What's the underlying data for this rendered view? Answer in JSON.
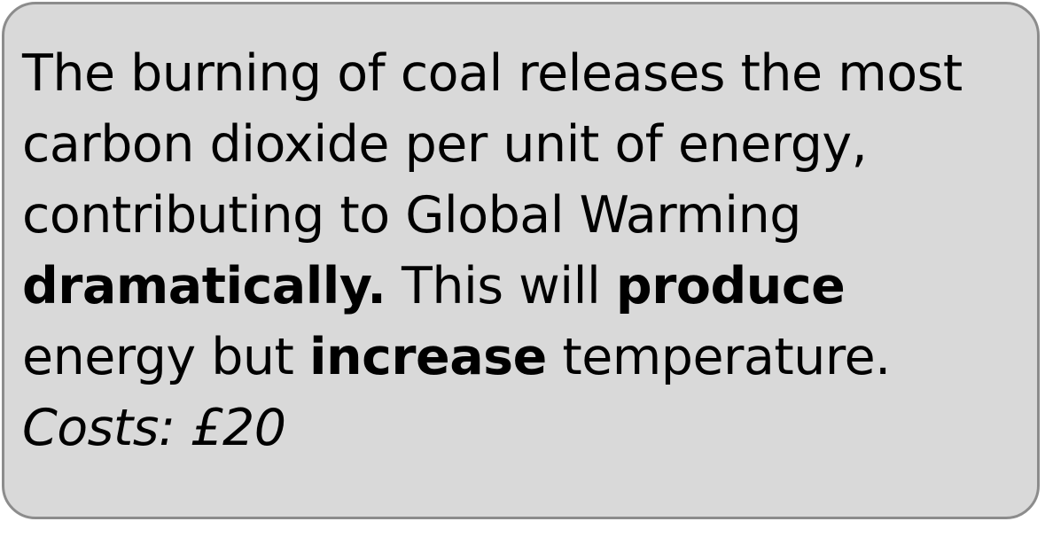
{
  "card": {
    "line1": "The burning of coal releases the most",
    "line2": "carbon dioxide per unit of energy,",
    "line3": "contributing to Global Warming",
    "line4_bold_a": "dramatically.",
    "line4_plain": " This will ",
    "line4_bold_b": "produce",
    "line5_plain_a": "energy but ",
    "line5_bold": "increase",
    "line5_plain_b": " temperature.",
    "cost": "Costs: £20"
  },
  "colors": {
    "background": "#d9d9d9",
    "border": "#8c8c8c",
    "text": "#000000"
  }
}
